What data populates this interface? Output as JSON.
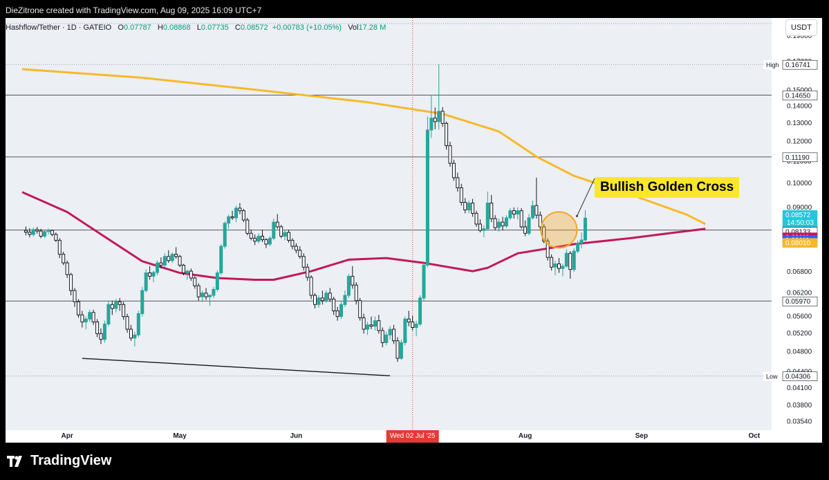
{
  "header": {
    "credit": "DieZitrone created with TradingView.com, Aug 09, 2025 16:09 UTC+7"
  },
  "legend": {
    "symbol": "Hashflow/Tether · 1D · GATEIO",
    "open_label": "O",
    "open": "0.07787",
    "high_label": "H",
    "high": "0.08868",
    "low_label": "L",
    "low": "0.07735",
    "close_label": "C",
    "close": "0.08572",
    "change": "+0.00783 (+10.05%)",
    "vol_label": "Vol",
    "vol": "17.28 M"
  },
  "currency_button": "USDT",
  "annotation": "Bullish Golden Cross",
  "brand": "TradingView",
  "colors": {
    "up": "#26a69a",
    "down": "#131722",
    "ma_long": "#f7b928",
    "ma_short": "#c2185b",
    "annotation_bg": "#fbe62e",
    "circle": "#f5a623"
  },
  "chart_data": {
    "type": "candlestick",
    "x_axis": {
      "labels": [
        "Apr",
        "May",
        "Jun",
        "Jul",
        "Aug",
        "Sep",
        "Oct"
      ],
      "highlight_label": "Wed 02 Jul '25"
    },
    "y_axis": {
      "scale": "log",
      "range": [
        0.034,
        0.205
      ],
      "ticks": [
        "0.19000",
        "0.17000",
        "0.15000",
        "0.14000",
        "0.13000",
        "0.12000",
        "0.11000",
        "0.10000",
        "0.09000",
        "0.06800",
        "0.06200",
        "0.05600",
        "0.05200",
        "0.04800",
        "0.04400",
        "0.04100",
        "0.03800",
        "0.03540"
      ]
    },
    "price_labels": [
      {
        "text": "0.16741",
        "label": "High",
        "value": 0.16741
      },
      {
        "text": "0.14650",
        "value": 0.1465
      },
      {
        "text": "0.11190",
        "value": 0.1119
      },
      {
        "text": "0.08572",
        "sub": "14:50:03",
        "value": 0.08572,
        "color": "#26c6da"
      },
      {
        "text": "0.08133",
        "value": 0.08133
      },
      {
        "text": "0.08111",
        "value": 0.08111,
        "color": "#c2185b"
      },
      {
        "text": "0.08111",
        "value": 0.08111,
        "color": "#2962ff"
      },
      {
        "text": "0.08010",
        "value": 0.0801,
        "color": "#f7b928"
      },
      {
        "text": "0.05970",
        "value": 0.0597
      },
      {
        "text": "0.04306",
        "label": "Low",
        "value": 0.04306
      }
    ],
    "horizontal_lines": [
      0.1465,
      0.1119,
      0.08133,
      0.0597
    ],
    "trendline": {
      "from": [
        "Apr 05",
        0.0465
      ],
      "to": [
        "Jun 26",
        0.0431
      ]
    },
    "ma_long_name": "",
    "ma_short_name": "",
    "ma_long": [
      [
        -12,
        0.164
      ],
      [
        20,
        0.158
      ],
      [
        50,
        0.15
      ],
      [
        80,
        0.142
      ],
      [
        100,
        0.135
      ],
      [
        115,
        0.125
      ],
      [
        125,
        0.112
      ],
      [
        135,
        0.103
      ],
      [
        150,
        0.095
      ],
      [
        165,
        0.087
      ],
      [
        170,
        0.0835
      ]
    ],
    "ma_short": [
      [
        -12,
        0.096
      ],
      [
        0,
        0.088
      ],
      [
        10,
        0.079
      ],
      [
        20,
        0.071
      ],
      [
        30,
        0.0675
      ],
      [
        40,
        0.066
      ],
      [
        50,
        0.0655
      ],
      [
        55,
        0.0655
      ],
      [
        65,
        0.068
      ],
      [
        75,
        0.0715
      ],
      [
        85,
        0.072
      ],
      [
        95,
        0.0705
      ],
      [
        108,
        0.068
      ],
      [
        112,
        0.069
      ],
      [
        120,
        0.0735
      ],
      [
        135,
        0.0765
      ],
      [
        150,
        0.0785
      ],
      [
        162,
        0.0805
      ],
      [
        170,
        0.0818
      ]
    ],
    "candles": [
      [
        -11,
        0.0812,
        0.0826,
        0.0795,
        0.0806
      ],
      [
        -10,
        0.0806,
        0.082,
        0.0788,
        0.0798
      ],
      [
        -9,
        0.0798,
        0.0822,
        0.0791,
        0.0815
      ],
      [
        -8,
        0.0815,
        0.0825,
        0.0801,
        0.081
      ],
      [
        -7,
        0.081,
        0.0818,
        0.0785,
        0.0792
      ],
      [
        -6,
        0.0792,
        0.0815,
        0.0786,
        0.0808
      ],
      [
        -5,
        0.0808,
        0.0819,
        0.0798,
        0.0812
      ],
      [
        -4,
        0.0812,
        0.0815,
        0.0792,
        0.0798
      ],
      [
        -3,
        0.0798,
        0.0805,
        0.0772,
        0.0778
      ],
      [
        -2,
        0.0778,
        0.0785,
        0.072,
        0.0732
      ],
      [
        -1,
        0.0732,
        0.074,
        0.0698,
        0.0705
      ],
      [
        0,
        0.0705,
        0.0712,
        0.066,
        0.067
      ],
      [
        1,
        0.067,
        0.0675,
        0.0612,
        0.0625
      ],
      [
        2,
        0.0625,
        0.0632,
        0.0582,
        0.0595
      ],
      [
        3,
        0.0595,
        0.0602,
        0.0555,
        0.0562
      ],
      [
        4,
        0.0562,
        0.0572,
        0.0532,
        0.0545
      ],
      [
        5,
        0.0545,
        0.0558,
        0.0528,
        0.0552
      ],
      [
        6,
        0.0552,
        0.0575,
        0.0545,
        0.0568
      ],
      [
        7,
        0.0568,
        0.0575,
        0.0538,
        0.0545
      ],
      [
        8,
        0.0545,
        0.0552,
        0.051,
        0.0518
      ],
      [
        9,
        0.0518,
        0.053,
        0.0495,
        0.0505
      ],
      [
        10,
        0.0505,
        0.0548,
        0.0498,
        0.054
      ],
      [
        11,
        0.054,
        0.0598,
        0.0535,
        0.0588
      ],
      [
        12,
        0.0588,
        0.0598,
        0.0562,
        0.0578
      ],
      [
        13,
        0.0578,
        0.0602,
        0.0568,
        0.0595
      ],
      [
        14,
        0.0595,
        0.0605,
        0.0572,
        0.0588
      ],
      [
        15,
        0.0588,
        0.0595,
        0.055,
        0.0558
      ],
      [
        16,
        0.0558,
        0.0565,
        0.052,
        0.0528
      ],
      [
        17,
        0.0528,
        0.0538,
        0.0502,
        0.0508
      ],
      [
        18,
        0.0508,
        0.0522,
        0.049,
        0.0515
      ],
      [
        19,
        0.0515,
        0.0572,
        0.051,
        0.0565
      ],
      [
        20,
        0.0565,
        0.0635,
        0.0558,
        0.0625
      ],
      [
        21,
        0.0625,
        0.0685,
        0.062,
        0.0675
      ],
      [
        22,
        0.0675,
        0.0695,
        0.0655,
        0.0665
      ],
      [
        23,
        0.0665,
        0.0682,
        0.0648,
        0.0676
      ],
      [
        24,
        0.0676,
        0.0712,
        0.0668,
        0.0705
      ],
      [
        25,
        0.0705,
        0.0722,
        0.0688,
        0.0698
      ],
      [
        26,
        0.0698,
        0.0735,
        0.0692,
        0.0725
      ],
      [
        27,
        0.0725,
        0.0745,
        0.0705,
        0.0712
      ],
      [
        28,
        0.0712,
        0.0738,
        0.0705,
        0.0732
      ],
      [
        29,
        0.0732,
        0.0755,
        0.0718,
        0.0725
      ],
      [
        30,
        0.0725,
        0.073,
        0.0692,
        0.0698
      ],
      [
        31,
        0.0698,
        0.0702,
        0.0668,
        0.0675
      ],
      [
        32,
        0.0675,
        0.0685,
        0.0655,
        0.068
      ],
      [
        33,
        0.068,
        0.0688,
        0.0652,
        0.066
      ],
      [
        34,
        0.066,
        0.0665,
        0.063,
        0.0638
      ],
      [
        35,
        0.0638,
        0.0645,
        0.0598,
        0.0608
      ],
      [
        36,
        0.0608,
        0.0625,
        0.0595,
        0.0618
      ],
      [
        37,
        0.0618,
        0.0632,
        0.06,
        0.0608
      ],
      [
        38,
        0.0608,
        0.0615,
        0.0585,
        0.0612
      ],
      [
        39,
        0.0612,
        0.0635,
        0.0605,
        0.0628
      ],
      [
        40,
        0.0628,
        0.0682,
        0.0622,
        0.0675
      ],
      [
        41,
        0.0675,
        0.0765,
        0.0668,
        0.0758
      ],
      [
        42,
        0.0758,
        0.0845,
        0.075,
        0.0838
      ],
      [
        43,
        0.0838,
        0.087,
        0.0818,
        0.0862
      ],
      [
        44,
        0.0862,
        0.0885,
        0.085,
        0.0858
      ],
      [
        45,
        0.0858,
        0.0905,
        0.0842,
        0.0895
      ],
      [
        46,
        0.0895,
        0.0915,
        0.0872,
        0.0885
      ],
      [
        47,
        0.0885,
        0.0892,
        0.0842,
        0.085
      ],
      [
        48,
        0.085,
        0.0858,
        0.0795,
        0.0802
      ],
      [
        49,
        0.0802,
        0.0815,
        0.0778,
        0.0785
      ],
      [
        50,
        0.0785,
        0.0798,
        0.0762,
        0.0775
      ],
      [
        51,
        0.0775,
        0.0802,
        0.0768,
        0.0792
      ],
      [
        52,
        0.0792,
        0.0815,
        0.0772,
        0.078
      ],
      [
        53,
        0.078,
        0.0785,
        0.0752,
        0.0765
      ],
      [
        54,
        0.0765,
        0.0792,
        0.0758,
        0.0785
      ],
      [
        55,
        0.0785,
        0.0855,
        0.0778,
        0.0842
      ],
      [
        56,
        0.0842,
        0.0872,
        0.0818,
        0.0825
      ],
      [
        57,
        0.0825,
        0.0832,
        0.0785,
        0.0792
      ],
      [
        58,
        0.0792,
        0.0812,
        0.0778,
        0.0805
      ],
      [
        59,
        0.0805,
        0.0815,
        0.077,
        0.0778
      ],
      [
        60,
        0.0778,
        0.0785,
        0.0748,
        0.0758
      ],
      [
        61,
        0.0758,
        0.0768,
        0.0735,
        0.0745
      ],
      [
        62,
        0.0745,
        0.0758,
        0.0718,
        0.0725
      ],
      [
        63,
        0.0725,
        0.0735,
        0.0682,
        0.0692
      ],
      [
        64,
        0.0692,
        0.0702,
        0.0652,
        0.0662
      ],
      [
        65,
        0.0662,
        0.0668,
        0.0602,
        0.0612
      ],
      [
        66,
        0.0612,
        0.0618,
        0.0578,
        0.0588
      ],
      [
        67,
        0.0588,
        0.0612,
        0.058,
        0.0605
      ],
      [
        68,
        0.0605,
        0.0625,
        0.0588,
        0.0598
      ],
      [
        69,
        0.0598,
        0.0625,
        0.0592,
        0.0618
      ],
      [
        70,
        0.0618,
        0.0632,
        0.0595,
        0.0602
      ],
      [
        71,
        0.0602,
        0.0608,
        0.0562,
        0.0572
      ],
      [
        72,
        0.0572,
        0.0582,
        0.0548,
        0.0558
      ],
      [
        73,
        0.0558,
        0.0595,
        0.0552,
        0.0588
      ],
      [
        74,
        0.0588,
        0.0625,
        0.0582,
        0.0612
      ],
      [
        75,
        0.0612,
        0.0672,
        0.0605,
        0.0665
      ],
      [
        76,
        0.0665,
        0.0695,
        0.063,
        0.064
      ],
      [
        77,
        0.064,
        0.0648,
        0.0588,
        0.0598
      ],
      [
        78,
        0.0598,
        0.0605,
        0.0548,
        0.0555
      ],
      [
        79,
        0.0555,
        0.0565,
        0.0518,
        0.0528
      ],
      [
        80,
        0.0528,
        0.0545,
        0.0515,
        0.0538
      ],
      [
        81,
        0.0538,
        0.0558,
        0.0528,
        0.0535
      ],
      [
        82,
        0.0535,
        0.0558,
        0.0525,
        0.0548
      ],
      [
        83,
        0.0548,
        0.0562,
        0.0518,
        0.0525
      ],
      [
        84,
        0.0525,
        0.0532,
        0.0488,
        0.0498
      ],
      [
        85,
        0.0498,
        0.0522,
        0.0492,
        0.0515
      ],
      [
        86,
        0.0515,
        0.0535,
        0.0505,
        0.0528
      ],
      [
        87,
        0.0528,
        0.0538,
        0.0495,
        0.0502
      ],
      [
        88,
        0.0502,
        0.051,
        0.0458,
        0.0465
      ],
      [
        89,
        0.0465,
        0.0505,
        0.0462,
        0.0498
      ],
      [
        90,
        0.0498,
        0.0558,
        0.0492,
        0.0552
      ],
      [
        91,
        0.0552,
        0.0572,
        0.0535,
        0.0545
      ],
      [
        92,
        0.0545,
        0.056,
        0.0525,
        0.0532
      ],
      [
        93,
        0.0532,
        0.0548,
        0.0512,
        0.054
      ],
      [
        94,
        0.054,
        0.0612,
        0.0535,
        0.0605
      ],
      [
        95,
        0.0605,
        0.0705,
        0.0598,
        0.0698
      ],
      [
        96,
        0.0698,
        0.1335,
        0.0692,
        0.1258
      ],
      [
        97,
        0.1258,
        0.1465,
        0.1215,
        0.1325
      ],
      [
        98,
        0.1325,
        0.1388,
        0.1262,
        0.1305
      ],
      [
        99,
        0.1305,
        0.1674,
        0.126,
        0.1365
      ],
      [
        100,
        0.1365,
        0.139,
        0.1275,
        0.1295
      ],
      [
        101,
        0.1295,
        0.1305,
        0.1155,
        0.1175
      ],
      [
        102,
        0.1175,
        0.1195,
        0.1072,
        0.1088
      ],
      [
        103,
        0.1088,
        0.1105,
        0.1008,
        0.1022
      ],
      [
        104,
        0.1022,
        0.1045,
        0.0962,
        0.0978
      ],
      [
        105,
        0.0978,
        0.0995,
        0.0905,
        0.0918
      ],
      [
        106,
        0.0918,
        0.0935,
        0.0875,
        0.0888
      ],
      [
        107,
        0.0888,
        0.0925,
        0.0875,
        0.0915
      ],
      [
        108,
        0.0915,
        0.0932,
        0.0862,
        0.0875
      ],
      [
        109,
        0.0875,
        0.0885,
        0.0825,
        0.0835
      ],
      [
        110,
        0.0835,
        0.0852,
        0.0805,
        0.0812
      ],
      [
        111,
        0.0812,
        0.083,
        0.0788,
        0.0818
      ],
      [
        112,
        0.0818,
        0.0962,
        0.0812,
        0.0915
      ],
      [
        113,
        0.0915,
        0.0948,
        0.0842,
        0.0855
      ],
      [
        114,
        0.0855,
        0.0868,
        0.0812,
        0.0822
      ],
      [
        115,
        0.0822,
        0.0855,
        0.0808,
        0.0842
      ],
      [
        116,
        0.0842,
        0.0862,
        0.0812,
        0.0828
      ],
      [
        117,
        0.0828,
        0.0868,
        0.082,
        0.0858
      ],
      [
        118,
        0.0858,
        0.0895,
        0.085,
        0.0885
      ],
      [
        119,
        0.0885,
        0.0898,
        0.0855,
        0.0872
      ],
      [
        120,
        0.0872,
        0.0898,
        0.0852,
        0.0885
      ],
      [
        121,
        0.0885,
        0.0895,
        0.0818,
        0.0825
      ],
      [
        122,
        0.0825,
        0.0848,
        0.0792,
        0.0802
      ],
      [
        123,
        0.0802,
        0.0872,
        0.0795,
        0.0858
      ],
      [
        124,
        0.0858,
        0.0925,
        0.0852,
        0.0905
      ],
      [
        125,
        0.0905,
        0.1022,
        0.0855,
        0.0868
      ],
      [
        126,
        0.0868,
        0.0882,
        0.0812,
        0.0825
      ],
      [
        127,
        0.0825,
        0.0835,
        0.0768,
        0.0775
      ],
      [
        128,
        0.0775,
        0.0785,
        0.0712,
        0.0722
      ],
      [
        129,
        0.0722,
        0.0732,
        0.0682,
        0.0692
      ],
      [
        130,
        0.0692,
        0.0712,
        0.0668,
        0.0702
      ],
      [
        131,
        0.0702,
        0.072,
        0.0675,
        0.0688
      ],
      [
        132,
        0.0688,
        0.0702,
        0.0665,
        0.0695
      ],
      [
        133,
        0.0695,
        0.0748,
        0.069,
        0.0735
      ],
      [
        134,
        0.0735,
        0.0742,
        0.0658,
        0.0685
      ],
      [
        135,
        0.0685,
        0.0752,
        0.0678,
        0.0742
      ],
      [
        136,
        0.0742,
        0.0778,
        0.0735,
        0.0768
      ],
      [
        137,
        0.0768,
        0.0805,
        0.0752,
        0.0779
      ],
      [
        138,
        0.0779,
        0.0887,
        0.0774,
        0.0857
      ]
    ]
  }
}
